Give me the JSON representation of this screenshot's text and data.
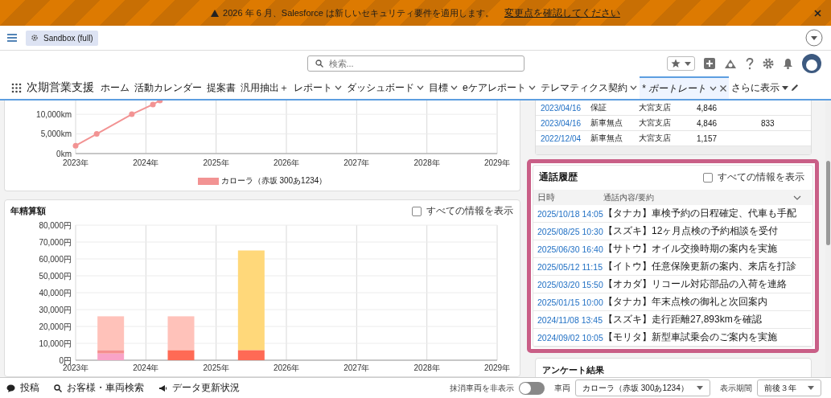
{
  "banner": {
    "message": "2026 年 6 月、Salesforce は新しいセキュリティ要件を適用します。",
    "link": "変更点を確認してください"
  },
  "org_badge": {
    "label": "Sandbox (full)"
  },
  "search": {
    "placeholder": "検索..."
  },
  "app_name": "次期営業支援",
  "tabs": [
    {
      "label": "ホーム",
      "selected": false,
      "menu": false
    },
    {
      "label": "活動カレンダー",
      "selected": false,
      "menu": false
    },
    {
      "label": "提案書",
      "selected": false,
      "menu": false
    },
    {
      "label": "汎用抽出＋",
      "selected": false,
      "menu": false
    },
    {
      "label": "レポート",
      "selected": false,
      "menu": true
    },
    {
      "label": "ダッシュボード",
      "selected": false,
      "menu": true
    },
    {
      "label": "目標",
      "selected": false,
      "menu": true
    },
    {
      "label": "eケアレポート",
      "selected": false,
      "menu": true
    },
    {
      "label": "テレマティクス契約",
      "selected": false,
      "menu": true
    },
    {
      "label": "* ポートレート",
      "selected": true,
      "menu": true
    }
  ],
  "more_tabs": "さらに表示",
  "mileage_card": {
    "chart_data": {
      "type": "line",
      "grid": true,
      "x": [
        2023,
        2023.3,
        2023.8,
        2024.1,
        2024.2
      ],
      "series": [
        {
          "name": "カローラ（赤坂 300あ1234）",
          "color": "#f29393",
          "marker": "circle",
          "values": [
            2000,
            5000,
            10000,
            12500,
            13500
          ]
        }
      ],
      "xlim": [
        2023,
        2029
      ],
      "ylim": [
        0,
        13500
      ],
      "xticks": [
        {
          "value": 2023,
          "label": "2023年"
        },
        {
          "value": 2024,
          "label": "2024年"
        },
        {
          "value": 2025,
          "label": "2025年"
        },
        {
          "value": 2026,
          "label": "2026年"
        },
        {
          "value": 2027,
          "label": "2027年"
        },
        {
          "value": 2028,
          "label": "2028年"
        },
        {
          "value": 2029,
          "label": "2029年"
        }
      ],
      "yticks": [
        {
          "value": 0,
          "label": "0km"
        },
        {
          "value": 5000,
          "label": "5,000km"
        },
        {
          "value": 10000,
          "label": "10,000km"
        }
      ]
    }
  },
  "settlement_card": {
    "title": "年精算額",
    "show_all": {
      "label": "すべての情報を表示",
      "checked": false
    },
    "chart_data": {
      "type": "bar",
      "grid": true,
      "stacked": true,
      "x": [
        2023.5,
        2024.5,
        2025.5
      ],
      "series": [
        {
          "color": "#f9a3c7",
          "values": [
            4000,
            null,
            null
          ]
        },
        {
          "color": "#f58f8f",
          "values": [
            2000,
            null,
            null
          ]
        },
        {
          "color": "#ff6a55",
          "values": [
            null,
            6000,
            6000
          ]
        },
        {
          "color": "#ffc2ba",
          "values": [
            20000,
            20000,
            null
          ]
        },
        {
          "color": "#ffd87a",
          "values": [
            null,
            null,
            59000
          ]
        }
      ],
      "xlim": [
        2023,
        2029
      ],
      "ylim": [
        0,
        80000
      ],
      "xticks": [
        {
          "value": 2023,
          "label": "2023年"
        },
        {
          "value": 2024,
          "label": "2024年"
        },
        {
          "value": 2025,
          "label": "2025年"
        },
        {
          "value": 2026,
          "label": "2026年"
        },
        {
          "value": 2027,
          "label": "2027年"
        },
        {
          "value": 2028,
          "label": "2028年"
        },
        {
          "value": 2029,
          "label": "2029年"
        }
      ],
      "yticks": [
        {
          "value": 0,
          "label": "0円"
        },
        {
          "value": 10000,
          "label": "10,000円"
        },
        {
          "value": 20000,
          "label": "20,000円"
        },
        {
          "value": 30000,
          "label": "30,000円"
        },
        {
          "value": 40000,
          "label": "40,000円"
        },
        {
          "value": 50000,
          "label": "50,000円"
        },
        {
          "value": 60000,
          "label": "60,000円"
        },
        {
          "value": 70000,
          "label": "70,000円"
        },
        {
          "value": 80000,
          "label": "80,000円"
        }
      ]
    }
  },
  "history_table": {
    "rows": [
      {
        "column_1": "2023/04/16",
        "column_2": "保証",
        "column_3": "大宮支店",
        "column_4": "4,846"
      },
      {
        "column_1": "2023/04/16",
        "column_2": "新車無点",
        "column_3": "大宮支店",
        "column_4": "4,846",
        "column_5": "833"
      },
      {
        "column_1": "2022/12/04",
        "column_2": "新車無点",
        "column_3": "大宮支店",
        "column_4": "1,157"
      }
    ]
  },
  "call_history": {
    "title": "通話履歴",
    "show_all": {
      "label": "すべての情報を表示",
      "checked": false
    },
    "columns": [
      "日時",
      "通話内容/要約"
    ],
    "rows": [
      {
        "datetime": "2025/10/18 14:05",
        "summary": "【タナカ】車検予約の日程確定、代車も手配"
      },
      {
        "datetime": "2025/08/25 10:30",
        "summary": "【スズキ】12ヶ月点検の予約相談を受付"
      },
      {
        "datetime": "2025/06/30 16:40",
        "summary": "【サトウ】オイル交換時期の案内を実施"
      },
      {
        "datetime": "2025/05/12 11:15",
        "summary": "【イトウ】任意保険更新の案内、来店を打診"
      },
      {
        "datetime": "2025/03/20 15:50",
        "summary": "【オカダ】リコール対応部品の入荷を連絡"
      },
      {
        "datetime": "2025/01/15 10:00",
        "summary": "【タナカ】年末点検の御礼と次回案内"
      },
      {
        "datetime": "2024/11/08 13:45",
        "summary": "【スズキ】走行距離27,893kmを確認"
      },
      {
        "datetime": "2024/09/02 10:05",
        "summary": "【モリタ】新型車試乗会のご案内を実施"
      }
    ]
  },
  "survey_card": {
    "title": "アンケート結果"
  },
  "footer": {
    "items": [
      {
        "label": "投稿",
        "kind": "chat"
      },
      {
        "label": "お客様・車両検索",
        "kind": "search"
      },
      {
        "label": "データ更新状況",
        "kind": "megaphone"
      }
    ],
    "hide_scrapped": {
      "label": "抹消車両を非表示",
      "on": false
    },
    "vehicle": {
      "label": "車両",
      "value": "カローラ（赤坂 300あ1234）"
    },
    "period": {
      "label": "表示期間",
      "value": "前後３年"
    }
  }
}
